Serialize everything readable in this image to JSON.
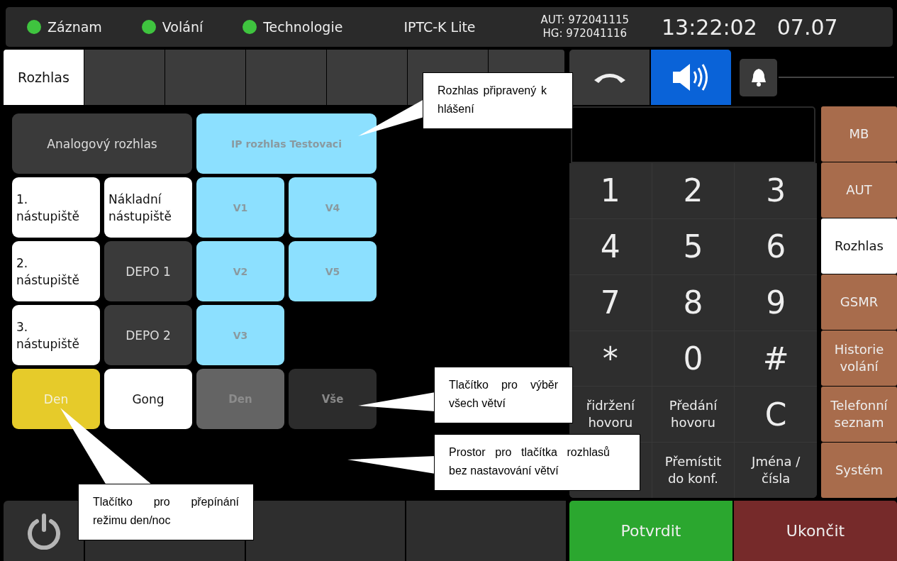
{
  "status_bar": {
    "indicators": [
      {
        "label": "Záznam",
        "color": "#3fc43f"
      },
      {
        "label": "Volání",
        "color": "#3fc43f"
      },
      {
        "label": "Technologie",
        "color": "#3fc43f"
      }
    ],
    "app_name": "IPTC-K Lite",
    "numbers": [
      "AUT: 972041115",
      "HG: 972041116"
    ],
    "time": "13:22:02",
    "date": "07.07"
  },
  "tabs": [
    {
      "label": "Rozhlas",
      "selected": true
    },
    {
      "selected": false
    },
    {
      "selected": false
    },
    {
      "selected": false
    },
    {
      "selected": false
    },
    {
      "selected": false
    },
    {
      "selected": false
    }
  ],
  "pad_rows": [
    [
      {
        "label": "Analogový rozhlas",
        "kind": "dark"
      },
      {
        "label": "IP rozhlas Testovaci",
        "kind": "branch"
      }
    ],
    [
      {
        "label": "1. nástupiště",
        "kind": "light"
      },
      {
        "label": "Nákladní nástupiště",
        "kind": "light"
      },
      {
        "label": "V1",
        "kind": "branch"
      },
      {
        "label": "V4",
        "kind": "branch"
      }
    ],
    [
      {
        "label": "2. nástupiště",
        "kind": "light"
      },
      {
        "label": "DEPO 1",
        "kind": "dark"
      },
      {
        "label": "V2",
        "kind": "branch"
      },
      {
        "label": "V5",
        "kind": "branch"
      }
    ],
    [
      {
        "label": "3. nástupiště",
        "kind": "light"
      },
      {
        "label": "DEPO 2",
        "kind": "dark"
      },
      {
        "label": "V3",
        "kind": "branch"
      }
    ],
    [
      {
        "label": "Den",
        "kind": "active"
      },
      {
        "label": "Gong",
        "kind": "white"
      },
      {
        "label": "Den",
        "kind": "disabled"
      },
      {
        "label": "Vše",
        "kind": "muted"
      }
    ]
  ],
  "call_controls": [
    {
      "kind": "hangup",
      "selected": false
    },
    {
      "kind": "speaker",
      "selected": true
    }
  ],
  "keypad": [
    {
      "label": "1",
      "kind": "digit"
    },
    {
      "label": "2",
      "kind": "digit"
    },
    {
      "label": "3",
      "kind": "digit"
    },
    {
      "label": "4",
      "kind": "digit"
    },
    {
      "label": "5",
      "kind": "digit"
    },
    {
      "label": "6",
      "kind": "digit"
    },
    {
      "label": "7",
      "kind": "digit"
    },
    {
      "label": "8",
      "kind": "digit"
    },
    {
      "label": "9",
      "kind": "digit"
    },
    {
      "label": "*",
      "kind": "digit"
    },
    {
      "label": "0",
      "kind": "digit"
    },
    {
      "label": "#",
      "kind": "digit"
    },
    {
      "label": "řidržení hovoru",
      "kind": "function"
    },
    {
      "label": "Předání hovoru",
      "kind": "function"
    },
    {
      "label": "C",
      "kind": "digit"
    },
    {
      "kind": "function"
    },
    {
      "label": "Přemístit do konf.",
      "kind": "function"
    },
    {
      "label": "Jména / čísla",
      "kind": "function"
    }
  ],
  "side_menu": [
    {
      "label": "MB",
      "selected": false
    },
    {
      "label": "AUT",
      "selected": false
    },
    {
      "label": "Rozhlas",
      "selected": true
    },
    {
      "label": "GSMR",
      "selected": false
    },
    {
      "label": "Historie volání",
      "selected": false
    },
    {
      "label": "Telefonní seznam",
      "selected": false
    },
    {
      "label": "Systém",
      "selected": false
    }
  ],
  "actions": [
    {
      "label": "Potvrdit",
      "kind": "confirm"
    },
    {
      "label": "Ukončit",
      "kind": "end"
    }
  ],
  "callouts": [
    {
      "text": "Rozhlas připravený k hlášení"
    },
    {
      "text": "Tlačítko pro výběr všech větví"
    },
    {
      "text": "Prostor pro tlačítka rozhlasů bez nastavování větví"
    },
    {
      "text": "Tlačítko pro přepínání režimu den/noc"
    }
  ]
}
